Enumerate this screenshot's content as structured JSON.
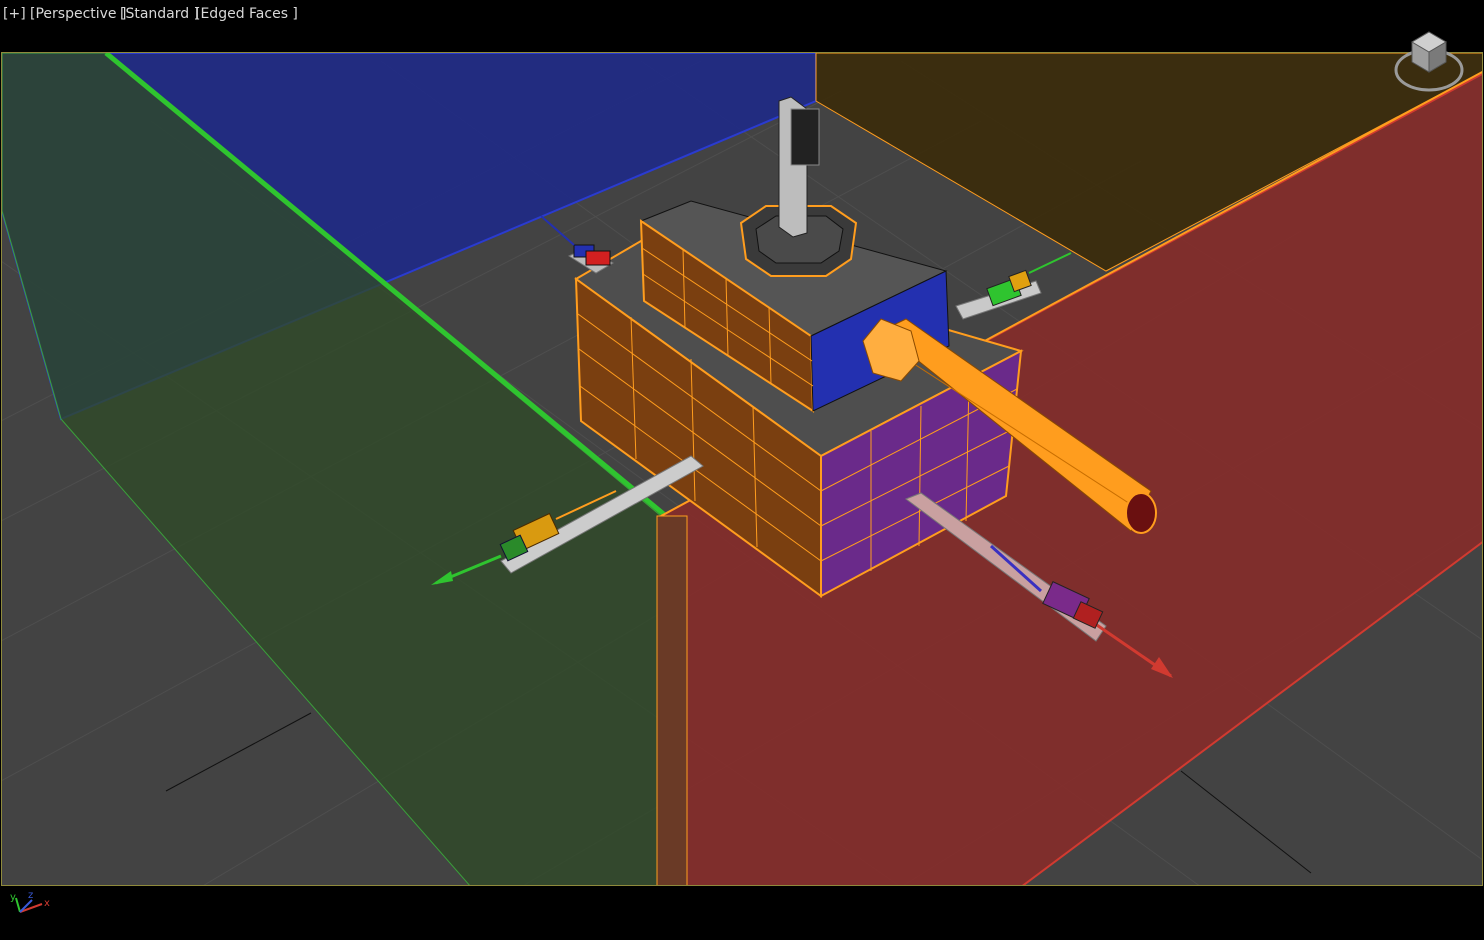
{
  "viewport": {
    "labels": {
      "menu": "[+]",
      "view": "[Perspective ]",
      "shading": "[Standard ]",
      "style": "[Edged Faces ]"
    }
  },
  "icons": {
    "viewcube": "viewcube-icon",
    "axis_tripod": "axis-tripod-icon"
  },
  "axis_labels": {
    "x": "x",
    "y": "y",
    "z": "z"
  },
  "colors": {
    "background": "#000000",
    "grid_floor": "#434343",
    "viewport_border": "#8f8a3c",
    "selection_orange": "#ff9d1e",
    "plane_blue": "#1f2a86",
    "plane_green": "#2f5a2a",
    "plane_red": "#8a2a28",
    "plane_yellow": "#3b2c0d"
  }
}
